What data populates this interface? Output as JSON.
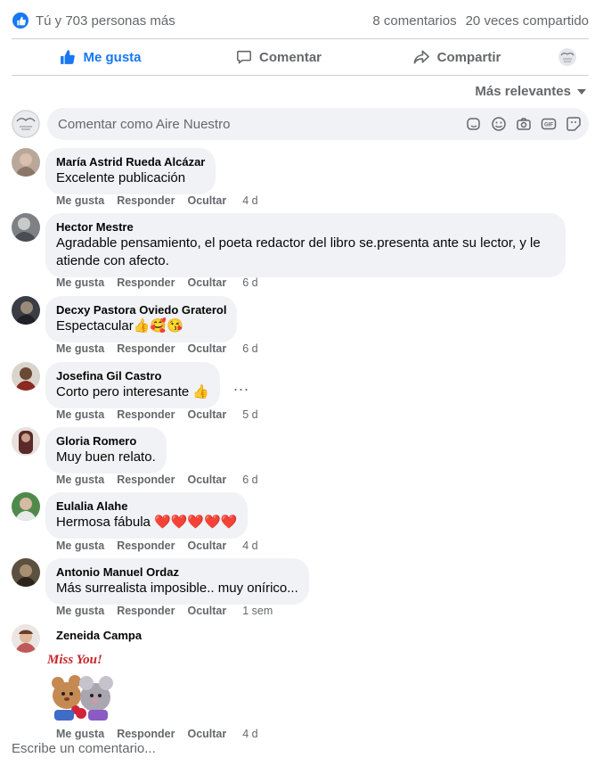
{
  "summary": {
    "likes_text": "Tú y 703 personas más",
    "comments_count": "8 comentarios",
    "shares_count": "20 veces compartido",
    "accent": "#1877f2"
  },
  "actions": {
    "like": "Me gusta",
    "comment": "Comentar",
    "share": "Compartir"
  },
  "sort": {
    "label": "Más relevantes"
  },
  "composer": {
    "placeholder": "Comentar como Aire Nuestro",
    "icons": [
      "avatar-sticker-icon",
      "emoji-icon",
      "camera-icon",
      "gif-icon",
      "sticker-icon"
    ]
  },
  "comment_actions": {
    "like": "Me gusta",
    "reply": "Responder",
    "hide": "Ocultar"
  },
  "comments": [
    {
      "author": "María Astrid Rueda Alcázar",
      "text": "Excelente publicación",
      "time": "4 d"
    },
    {
      "author": "Hector Mestre",
      "text": "Agradable pensamiento, el poeta redactor del libro se.presenta ante su lector, y le",
      "text2": "atiende con afecto.",
      "time": "6 d"
    },
    {
      "author": "Decxy Pastora Oviedo Graterol",
      "text": "Espectacular👍🥰😘",
      "time": "6 d"
    },
    {
      "author": "Josefina Gil Castro",
      "text": "Corto pero interesante 👍",
      "time": "5 d"
    },
    {
      "author": "Gloria Romero",
      "text": "Muy buen relato.",
      "time": "6 d"
    },
    {
      "author": "Eulalia Alahe",
      "text": "Hermosa fábula ❤️❤️❤️❤️❤️",
      "time": "4 d"
    },
    {
      "author": "Antonio Manuel Ordaz",
      "text": "Más surrealista imposible.. muy onírico...",
      "time": "1 sem"
    },
    {
      "author": "Zeneida Campa",
      "sticker_text": "Miss You!",
      "time": "4 d"
    }
  ],
  "more_label": "...",
  "write_placeholder": "Escribe un comentario..."
}
